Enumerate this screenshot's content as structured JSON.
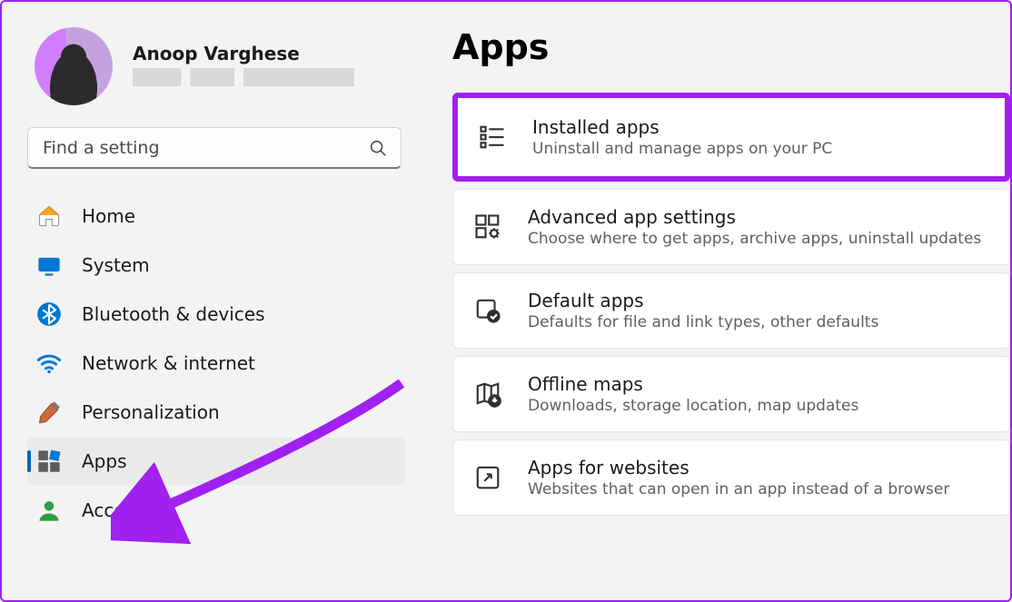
{
  "user": {
    "name": "Anoop Varghese"
  },
  "search": {
    "placeholder": "Find a setting"
  },
  "nav": {
    "home": "Home",
    "system": "System",
    "bluetooth": "Bluetooth & devices",
    "network": "Network & internet",
    "personalization": "Personalization",
    "apps": "Apps",
    "accounts": "Accounts"
  },
  "page": {
    "title": "Apps"
  },
  "cards": {
    "installed": {
      "title": "Installed apps",
      "sub": "Uninstall and manage apps on your PC"
    },
    "advanced": {
      "title": "Advanced app settings",
      "sub": "Choose where to get apps, archive apps, uninstall updates"
    },
    "defaults": {
      "title": "Default apps",
      "sub": "Defaults for file and link types, other defaults"
    },
    "maps": {
      "title": "Offline maps",
      "sub": "Downloads, storage location, map updates"
    },
    "websites": {
      "title": "Apps for websites",
      "sub": "Websites that can open in an app instead of a browser"
    }
  }
}
